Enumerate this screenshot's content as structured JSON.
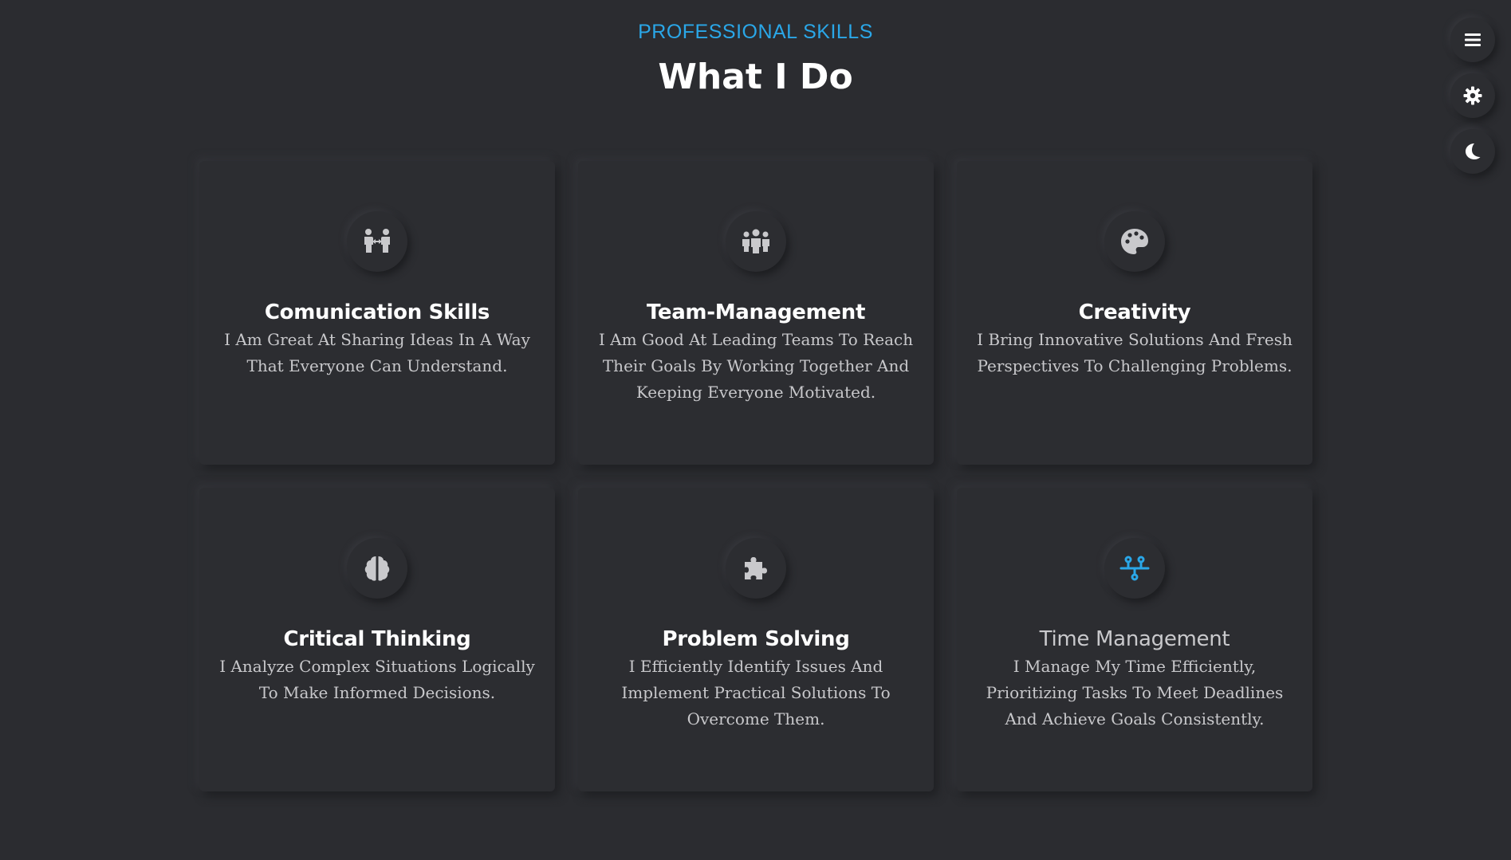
{
  "header": {
    "subtitle": "PROFESSIONAL SKILLS",
    "title": "What I Do"
  },
  "colors": {
    "accent": "#2aa7e8",
    "background": "#2b2c30",
    "icon": "#c9c9cc"
  },
  "skills": [
    {
      "icon": "people-arrows-icon",
      "title": "Comunication Skills",
      "description": "I Am Great At Sharing Ideas In A Way That Everyone Can Understand."
    },
    {
      "icon": "people-group-icon",
      "title": "Team-Management",
      "description": "I Am Good At Leading Teams To Reach Their Goals By Working Together And Keeping Everyone Motivated."
    },
    {
      "icon": "palette-icon",
      "title": "Creativity",
      "description": "I Bring Innovative Solutions And Fresh Perspectives To Challenging Problems."
    },
    {
      "icon": "brain-icon",
      "title": "Critical Thinking",
      "description": "I Analyze Complex Situations Logically To Make Informed Decisions."
    },
    {
      "icon": "puzzle-piece-icon",
      "title": "Problem Solving",
      "description": "I Efficiently Identify Issues And Implement Practical Solutions To Overcome Them."
    },
    {
      "icon": "timeline-icon",
      "title": "Time Management",
      "description": "I Manage My Time Efficiently, Prioritizing Tasks To Meet Deadlines And Achieve Goals Consistently."
    }
  ],
  "side_buttons": [
    {
      "icon": "menu-icon"
    },
    {
      "icon": "gear-icon"
    },
    {
      "icon": "moon-icon"
    }
  ]
}
